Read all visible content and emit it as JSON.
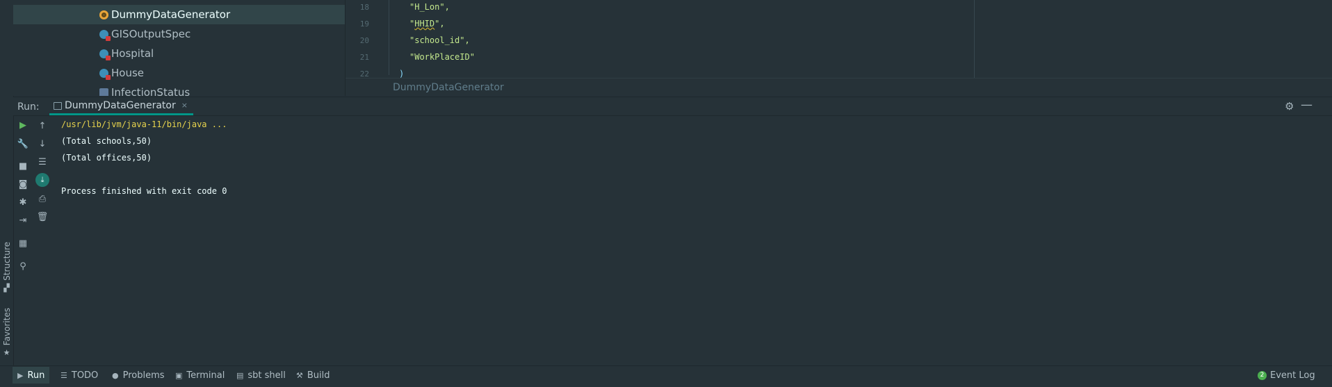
{
  "project_tree": {
    "items": [
      {
        "label": "DummyDataGenerator",
        "icon": "scala-object-icon",
        "selected": true
      },
      {
        "label": "GISOutputSpec",
        "icon": "scala-class-icon",
        "selected": false
      },
      {
        "label": "Hospital",
        "icon": "scala-class-icon",
        "selected": false
      },
      {
        "label": "House",
        "icon": "scala-class-icon",
        "selected": false
      },
      {
        "label": "InfectionStatus",
        "icon": "scala-trait-icon",
        "selected": false
      }
    ]
  },
  "editor": {
    "lines": [
      {
        "num": "18",
        "text": "\"H_Lon\","
      },
      {
        "num": "19",
        "pre": "\"",
        "warn": "HHID",
        "post": "\","
      },
      {
        "num": "20",
        "text": "\"school_id\","
      },
      {
        "num": "21",
        "text": "\"WorkPlaceID\""
      },
      {
        "num": "22",
        "text": ")"
      }
    ],
    "breadcrumb": "DummyDataGenerator"
  },
  "run_window": {
    "title": "Run:",
    "tab_label": "DummyDataGenerator",
    "tab_close": "×",
    "settings_icon": "gear-icon",
    "minimize_icon": "minimize-icon"
  },
  "left_toolbar": [
    "rerun-icon",
    "wrench-icon",
    "stop-icon",
    "camera-icon",
    "debug-icon",
    "login-icon",
    "layout-icon",
    "pin-icon"
  ],
  "right_toolbar": [
    "arrow-up-icon",
    "arrow-down-icon",
    "soft-wrap-icon",
    "scroll-to-end-icon",
    "print-icon",
    "trash-icon"
  ],
  "console": {
    "lines": [
      "/usr/lib/jvm/java-11/bin/java ...",
      "(Total schools,50)",
      "(Total offices,50)",
      "",
      "Process finished with exit code 0"
    ]
  },
  "side_tabs": {
    "structure": "Structure",
    "favorites": "Favorites"
  },
  "bottom_bar": {
    "tabs": [
      {
        "label": "Run",
        "icon": "play-icon"
      },
      {
        "label": "TODO",
        "icon": "list-icon"
      },
      {
        "label": "Problems",
        "icon": "info-icon"
      },
      {
        "label": "Terminal",
        "icon": "terminal-icon"
      },
      {
        "label": "sbt shell",
        "icon": "sbt-icon"
      },
      {
        "label": "Build",
        "icon": "hammer-icon"
      }
    ],
    "event_log": {
      "label": "Event Log",
      "badge": "2"
    }
  },
  "colors": {
    "accent": "#009688",
    "background": "#263238",
    "selection": "#314549",
    "string": "#c3e88d",
    "command": "#e8d44d"
  }
}
